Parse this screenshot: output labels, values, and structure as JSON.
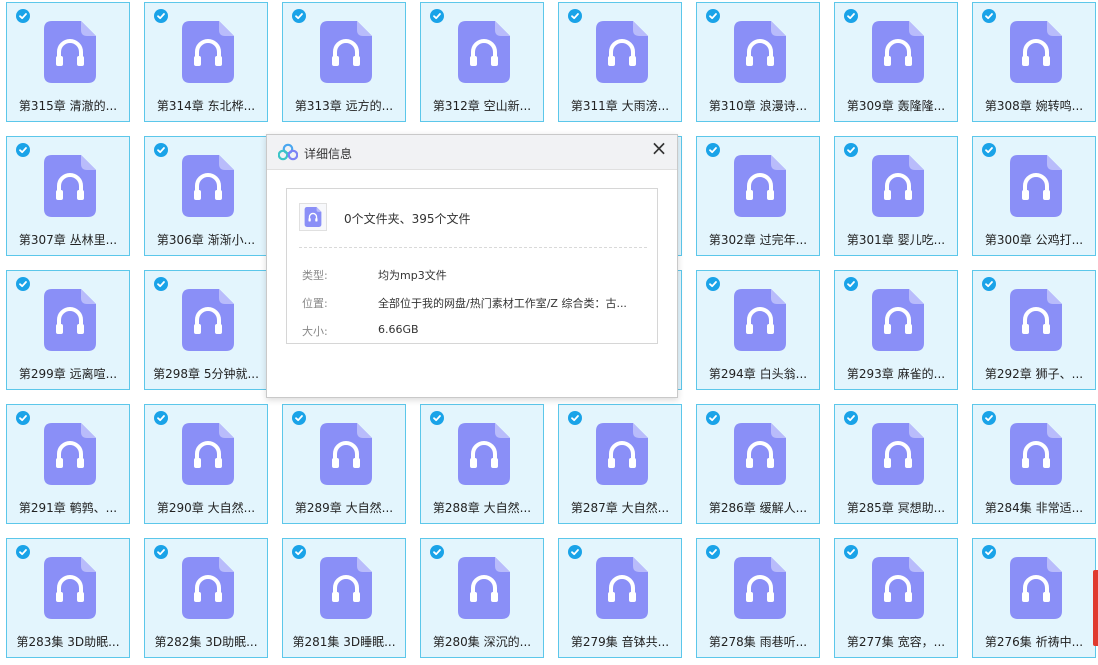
{
  "files": [
    {
      "label": "第315章 清澈的..."
    },
    {
      "label": "第314章 东北桦..."
    },
    {
      "label": "第313章 远方的..."
    },
    {
      "label": "第312章 空山新..."
    },
    {
      "label": "第311章 大雨滂..."
    },
    {
      "label": "第310章 浪漫诗..."
    },
    {
      "label": "第309章 轰隆隆..."
    },
    {
      "label": "第308章 婉转鸣..."
    },
    {
      "label": "第307章 丛林里..."
    },
    {
      "label": "第306章 渐渐小..."
    },
    {
      "label": ""
    },
    {
      "label": ""
    },
    {
      "label": ""
    },
    {
      "label": "第302章 过完年..."
    },
    {
      "label": "第301章 婴儿吃..."
    },
    {
      "label": "第300章 公鸡打..."
    },
    {
      "label": "第299章 远离喧..."
    },
    {
      "label": "第298章 5分钟就..."
    },
    {
      "label": ""
    },
    {
      "label": ""
    },
    {
      "label": ""
    },
    {
      "label": "第294章 白头翁..."
    },
    {
      "label": "第293章 麻雀的..."
    },
    {
      "label": "第292章 狮子、..."
    },
    {
      "label": "第291章 鹌鹑、..."
    },
    {
      "label": "第290章 大自然..."
    },
    {
      "label": "第289章 大自然..."
    },
    {
      "label": "第288章 大自然..."
    },
    {
      "label": "第287章 大自然..."
    },
    {
      "label": "第286章 缓解人..."
    },
    {
      "label": "第285章 冥想助..."
    },
    {
      "label": "第284集 非常适..."
    },
    {
      "label": "第283集 3D助眠..."
    },
    {
      "label": "第282集 3D助眠..."
    },
    {
      "label": "第281集 3D睡眠..."
    },
    {
      "label": "第280集 深沉的..."
    },
    {
      "label": "第279集 音钵共..."
    },
    {
      "label": "第278集 雨巷听..."
    },
    {
      "label": "第277集 宽容，..."
    },
    {
      "label": "第276集 祈祷中..."
    }
  ],
  "file_icon": "headphones-audio-file-icon",
  "dialog": {
    "title": "详细信息",
    "close_label": "×",
    "summary": "0个文件夹、395个文件",
    "rows": [
      {
        "label": "类型:",
        "value": "均为mp3文件"
      },
      {
        "label": "位置:",
        "value": "全部位于我的网盘/热门素材工作室/Z 综合类：古..."
      },
      {
        "label": "大小:",
        "value": "6.66GB"
      }
    ]
  },
  "colors": {
    "tile_bg": "#e3f5fd",
    "tile_border": "#5cc7ea",
    "check": "#1aa3e8",
    "file_icon": "#8a8ff7"
  }
}
